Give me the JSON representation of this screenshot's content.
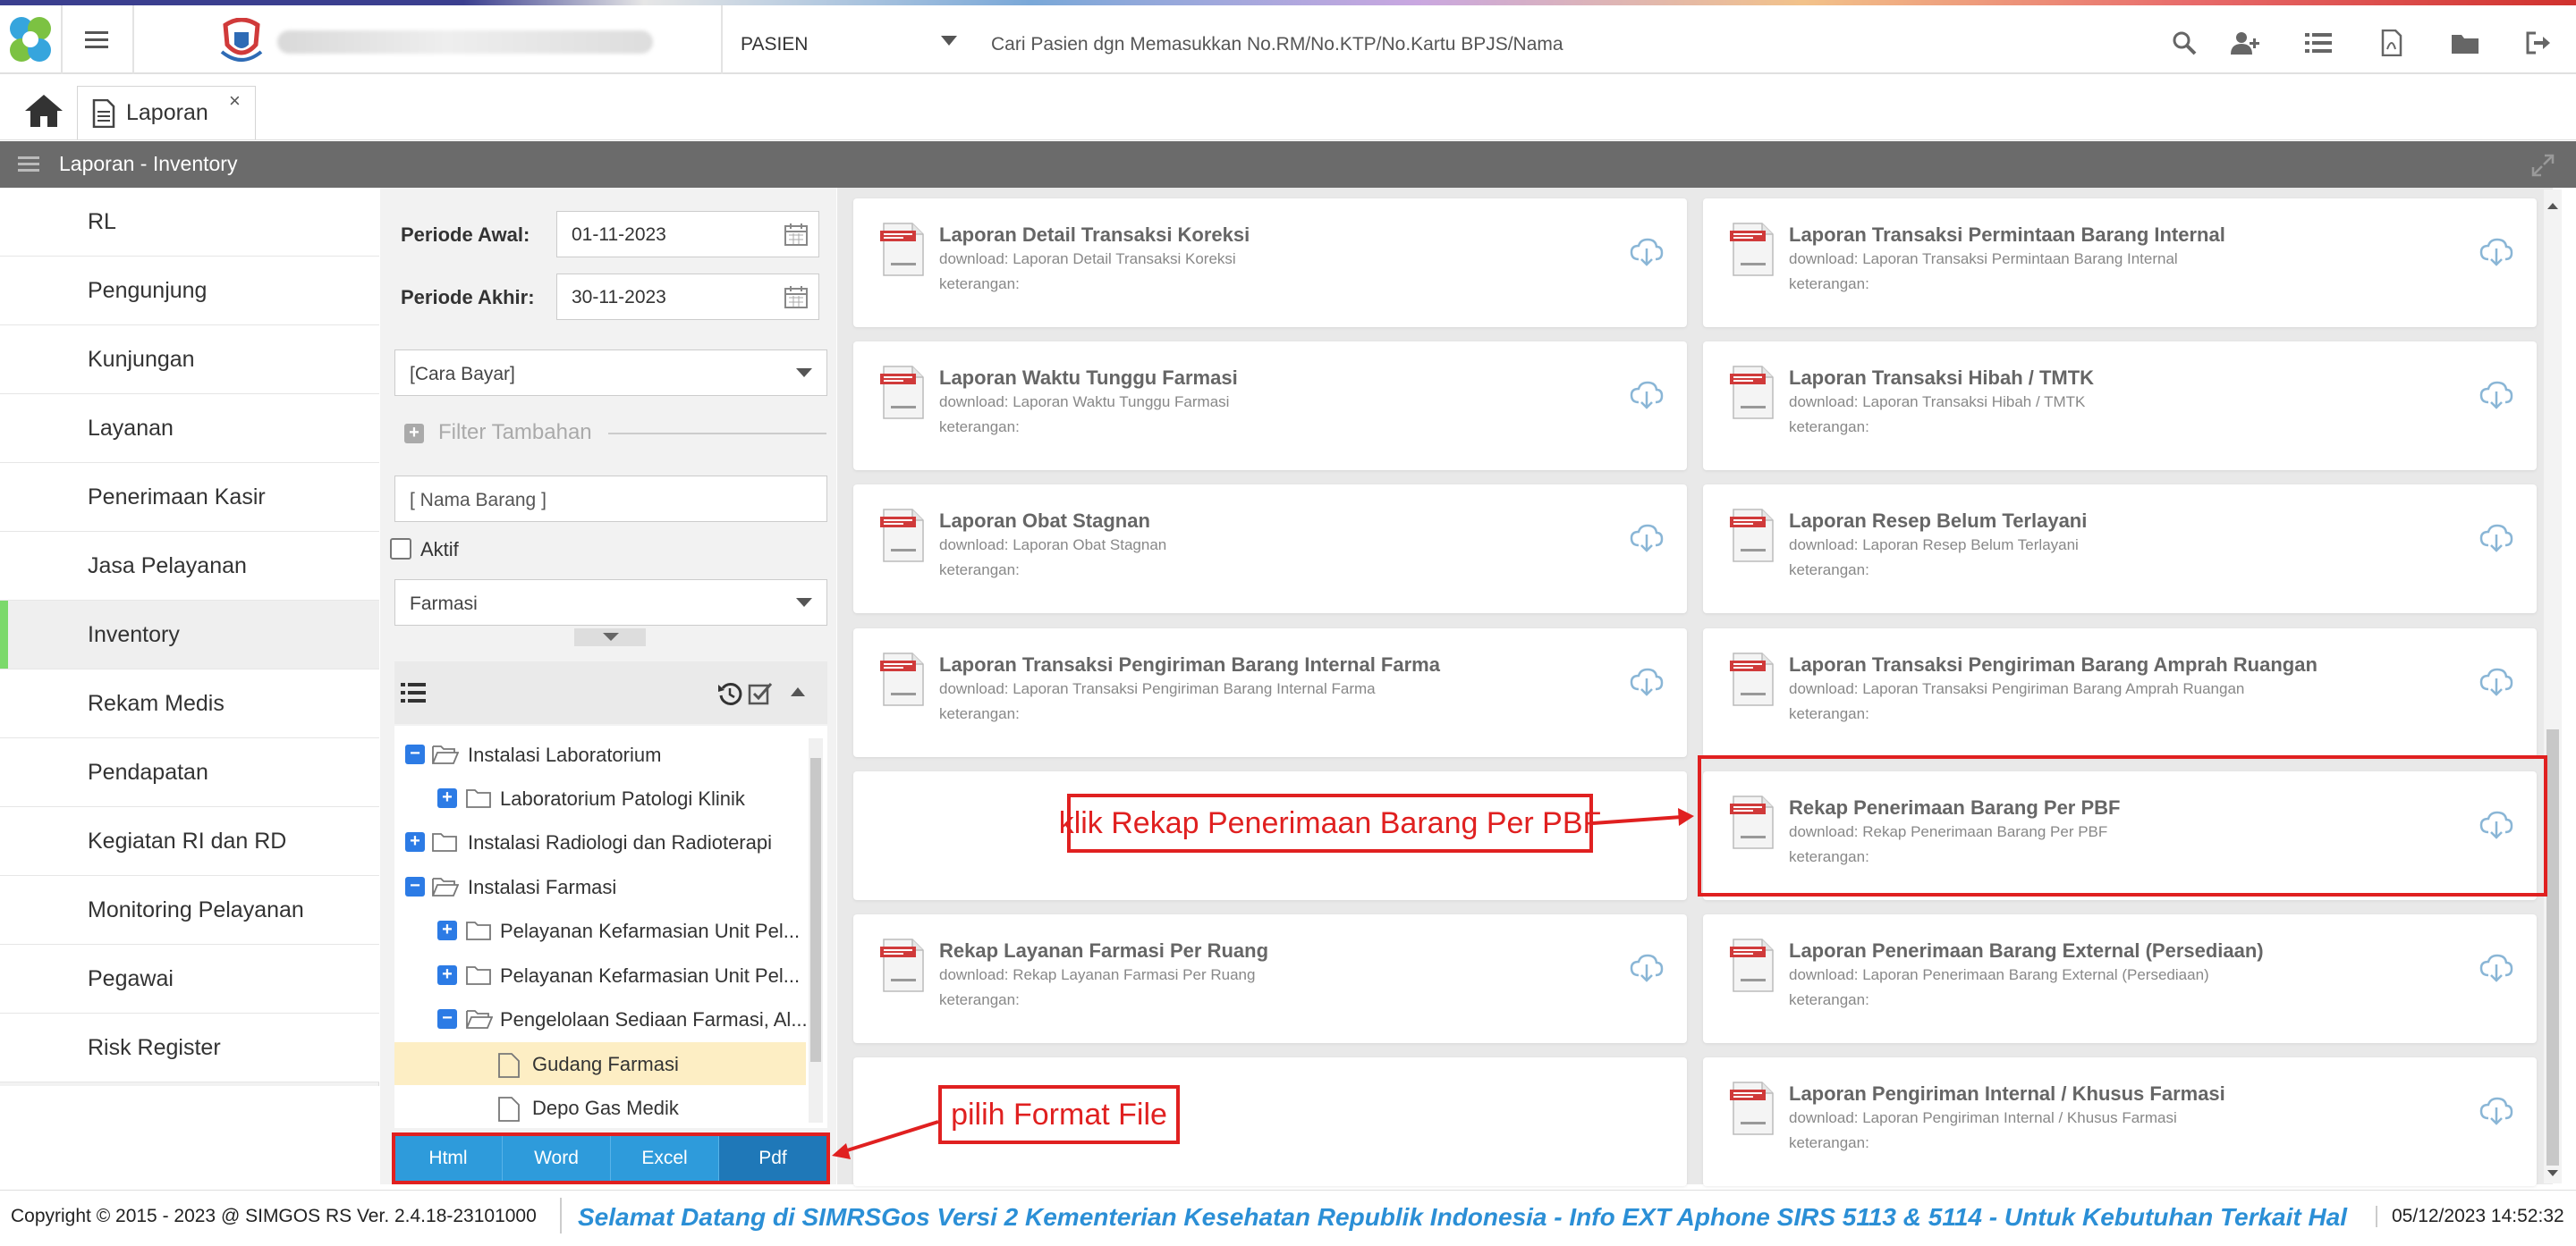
{
  "topbar": {
    "patient_selector": "PASIEN",
    "search_placeholder": "Cari Pasien dgn Memasukkan No.RM/No.KTP/No.Kartu BPJS/Nama",
    "icons": [
      "search-icon",
      "add-user-icon",
      "list-icon",
      "pdf-icon",
      "folder-icon",
      "logout-icon"
    ]
  },
  "tabs": [
    {
      "label": "Laporan",
      "close": "×"
    }
  ],
  "section": {
    "title": "Laporan - Inventory"
  },
  "sidebar": {
    "items": [
      {
        "label": "RL"
      },
      {
        "label": "Pengunjung"
      },
      {
        "label": "Kunjungan"
      },
      {
        "label": "Layanan"
      },
      {
        "label": "Penerimaan Kasir"
      },
      {
        "label": "Jasa Pelayanan"
      },
      {
        "label": "Inventory",
        "active": true
      },
      {
        "label": "Rekam Medis"
      },
      {
        "label": "Pendapatan"
      },
      {
        "label": "Kegiatan RI dan RD"
      },
      {
        "label": "Monitoring Pelayanan"
      },
      {
        "label": "Pegawai"
      },
      {
        "label": "Risk Register"
      }
    ]
  },
  "filters": {
    "periode_awal_label": "Periode Awal:",
    "periode_awal_value": "01-11-2023",
    "periode_akhir_label": "Periode Akhir:",
    "periode_akhir_value": "30-11-2023",
    "cara_bayar": "[Cara Bayar]",
    "filter_tambahan": "Filter Tambahan",
    "nama_barang": "[ Nama Barang ]",
    "aktif_label": "Aktif",
    "ruangan": "Farmasi"
  },
  "tree": {
    "items": [
      {
        "label": "Instalasi Laboratorium",
        "toggle": "−"
      },
      {
        "label": "Laboratorium Patologi Klinik",
        "toggle": "+"
      },
      {
        "label": "Instalasi Radiologi dan Radioterapi",
        "toggle": "+"
      },
      {
        "label": "Instalasi Farmasi",
        "toggle": "−"
      },
      {
        "label": "Pelayanan Kefarmasian Unit Pel...",
        "toggle": "+"
      },
      {
        "label": "Pelayanan Kefarmasian Unit Pel...",
        "toggle": "+"
      },
      {
        "label": "Pengelolaan Sediaan Farmasi, Al...",
        "toggle": "−"
      },
      {
        "label": "Gudang Farmasi",
        "selected": true
      },
      {
        "label": "Depo Gas Medik"
      }
    ]
  },
  "formats": [
    {
      "label": "Html"
    },
    {
      "label": "Word"
    },
    {
      "label": "Excel"
    },
    {
      "label": "Pdf",
      "active": true
    }
  ],
  "reports": [
    {
      "title": "Laporan Detail Transaksi Koreksi",
      "download": "download: Laporan Detail Transaksi Koreksi",
      "keterangan": "keterangan:"
    },
    {
      "title": "Laporan Transaksi Permintaan Barang Internal",
      "download": "download: Laporan Transaksi Permintaan Barang Internal",
      "keterangan": "keterangan:"
    },
    {
      "title": "Laporan Waktu Tunggu Farmasi",
      "download": "download: Laporan Waktu Tunggu Farmasi",
      "keterangan": "keterangan:"
    },
    {
      "title": "Laporan Transaksi Hibah / TMTK",
      "download": "download: Laporan Transaksi Hibah / TMTK",
      "keterangan": "keterangan:"
    },
    {
      "title": "Laporan Obat Stagnan",
      "download": "download: Laporan Obat Stagnan",
      "keterangan": "keterangan:"
    },
    {
      "title": "Laporan Resep Belum Terlayani",
      "download": "download: Laporan Resep Belum Terlayani",
      "keterangan": "keterangan:"
    },
    {
      "title": "Laporan Transaksi Pengiriman Barang Internal Farma",
      "download": "download: Laporan Transaksi Pengiriman Barang Internal Farma",
      "keterangan": "keterangan:"
    },
    {
      "title": "Laporan Transaksi Pengiriman Barang Amprah Ruangan",
      "download": "download: Laporan Transaksi Pengiriman Barang Amprah Ruangan",
      "keterangan": "keterangan:"
    },
    {
      "title": "Rekap Penerimaan Barang Per PBF",
      "download": "download: Rekap Penerimaan Barang Per PBF",
      "keterangan": "keterangan:"
    },
    {
      "title": "Rekap Layanan Farmasi Per Ruang",
      "download": "download: Rekap Layanan Farmasi Per Ruang",
      "keterangan": "keterangan:"
    },
    {
      "title": "Laporan Penerimaan Barang External (Persediaan)",
      "download": "download: Laporan Penerimaan Barang External (Persediaan)",
      "keterangan": "keterangan:"
    },
    {
      "title": "Laporan Pengiriman Internal / Khusus Farmasi",
      "download": "download: Laporan Pengiriman Internal / Khusus Farmasi",
      "keterangan": "keterangan:"
    }
  ],
  "annotations": {
    "rekap_callout": "klik Rekap Penerimaan Barang Per PBF",
    "format_callout": "pilih Format File",
    "color": "#e02020"
  },
  "footer": {
    "copyright": "Copyright © 2015 - 2023 @ SIMGOS RS Ver. 2.4.18-23101000",
    "marquee": "Selamat Datang di SIMRSGos Versi 2 Kementerian Kesehatan Republik Indonesia - Info EXT Aphone SIRS 5113 & 5114 - Untuk Kebutuhan Terkait Hal",
    "datetime": "05/12/2023 14:52:32"
  },
  "colors": {
    "accent": "#2e9bdb",
    "header_gray": "#6b6b6b",
    "active_nav": "#7bd96b",
    "marquee": "#2b8fd6"
  }
}
